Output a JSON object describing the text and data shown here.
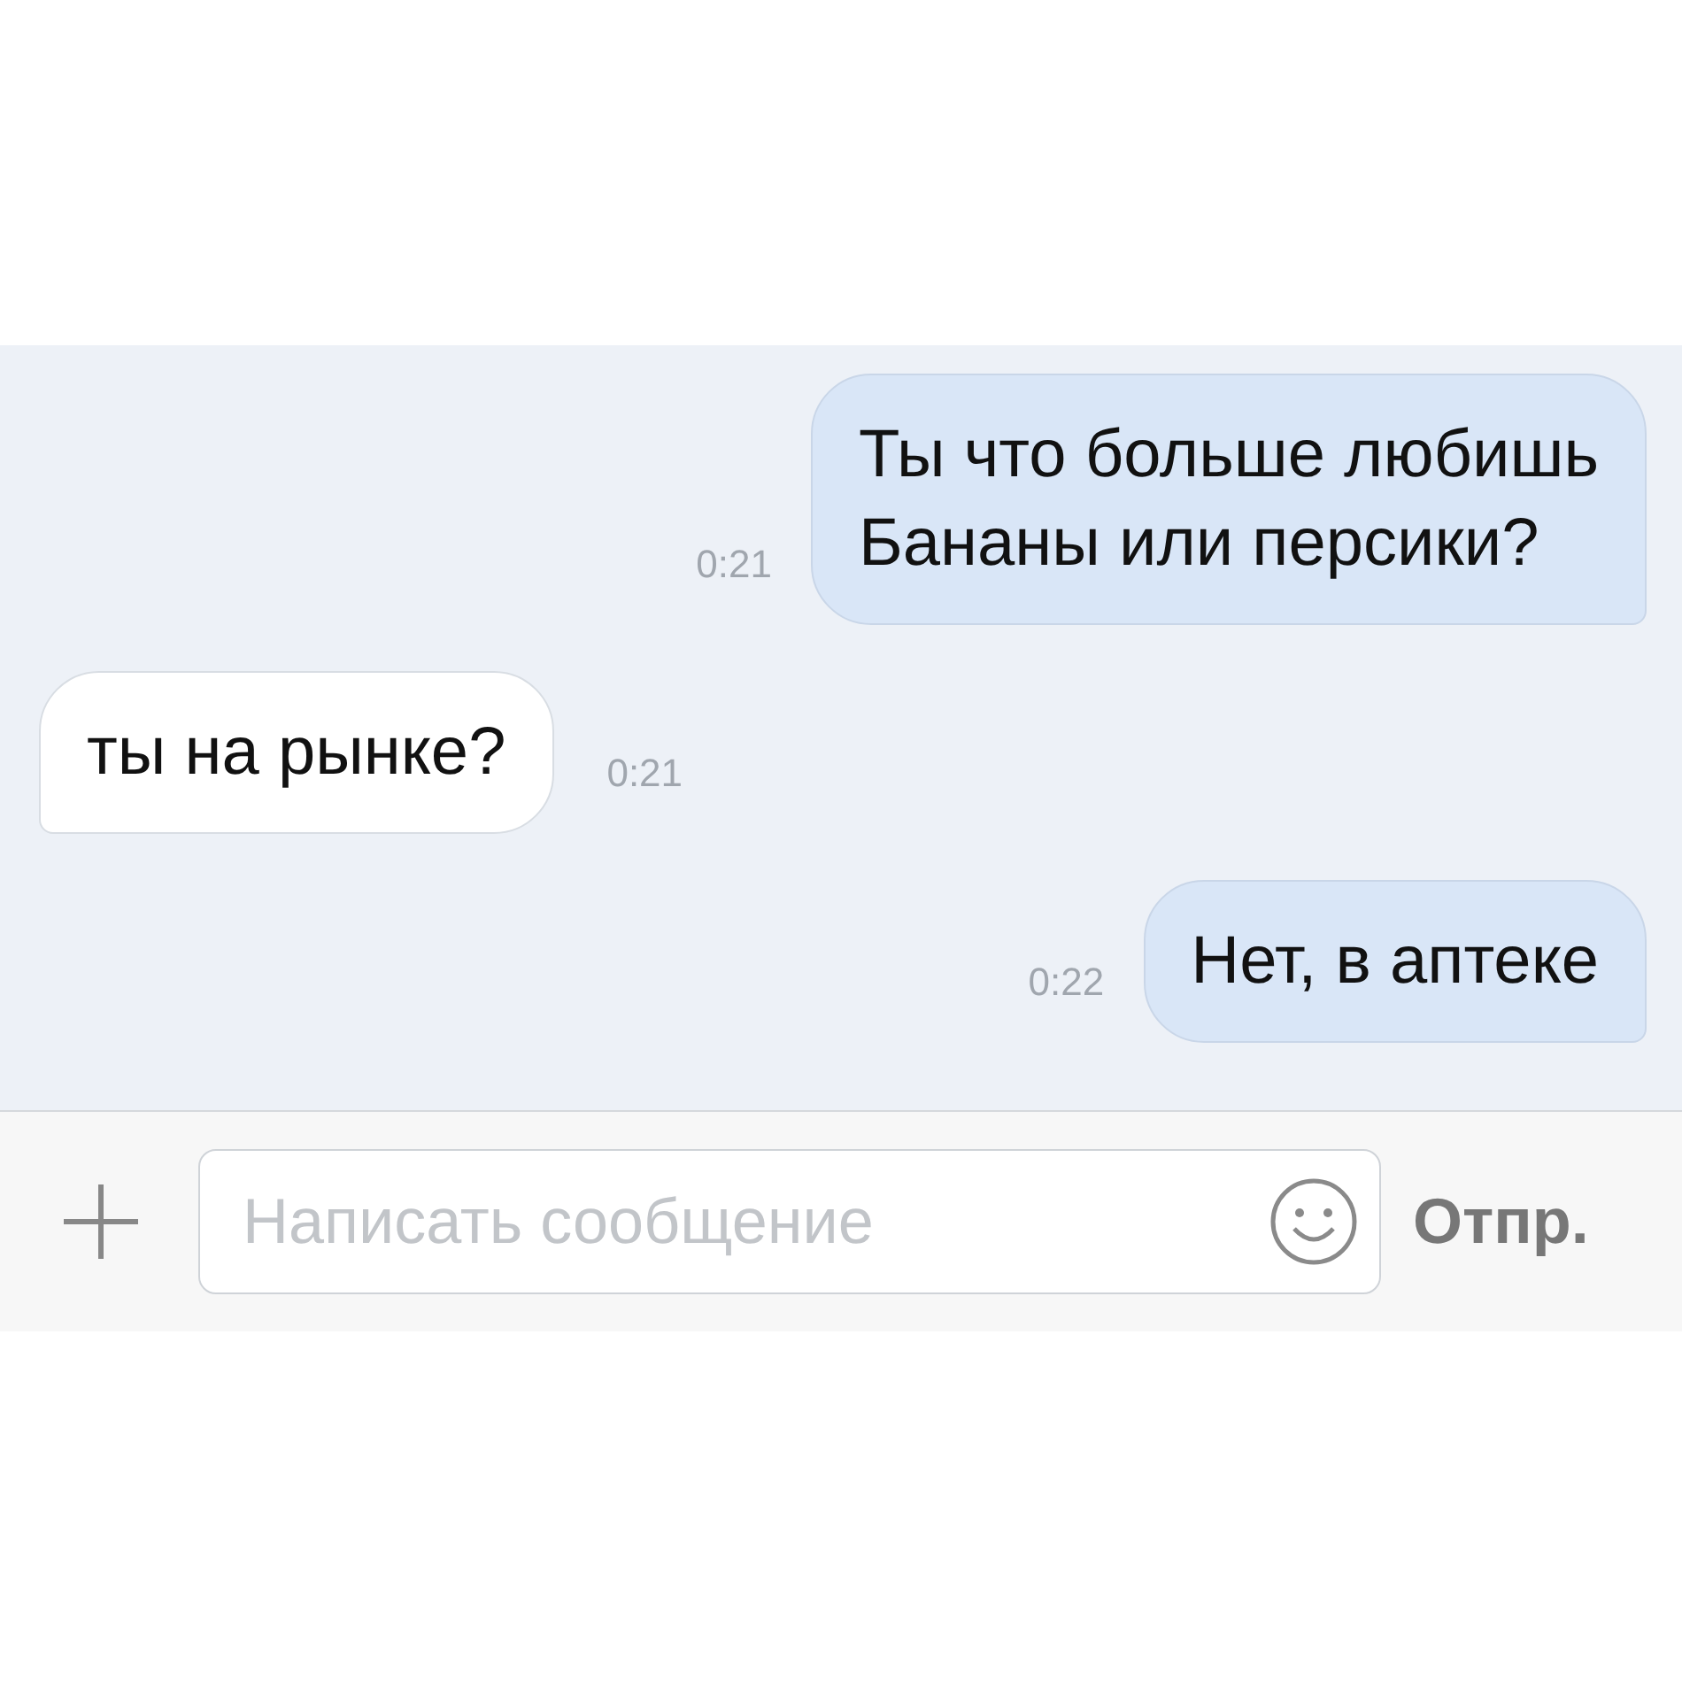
{
  "messages": [
    {
      "kind": "outgoing",
      "text": "Ты что больше любишь\nБананы или персики?",
      "time": "0:21"
    },
    {
      "kind": "incoming",
      "text": "ты на рынке?",
      "time": "0:21"
    },
    {
      "kind": "outgoing",
      "text": "Нет, в аптеке",
      "time": "0:22"
    }
  ],
  "composer": {
    "placeholder": "Написать сообщение",
    "send": "Отпр."
  }
}
